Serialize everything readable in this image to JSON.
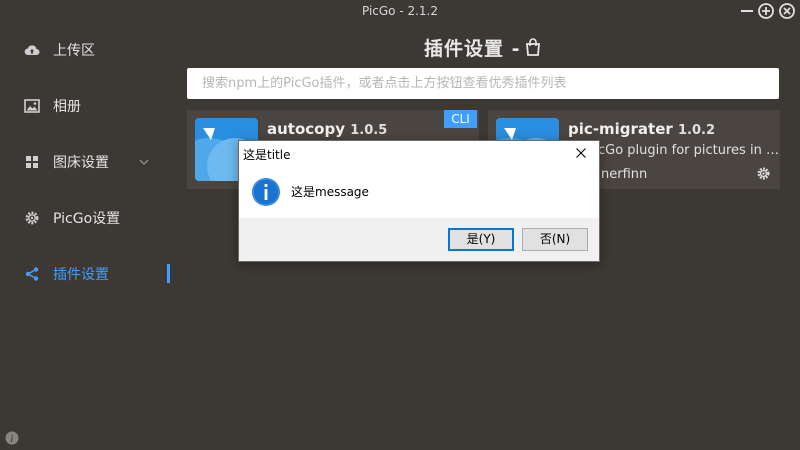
{
  "window": {
    "title": "PicGo - 2.1.2",
    "minimize_icon": "minimize-icon",
    "maximize_icon": "plus-circle-icon",
    "close_icon": "close-circle-icon"
  },
  "sidebar": {
    "items": [
      {
        "label": "上传区",
        "icon": "cloud-upload-icon"
      },
      {
        "label": "相册",
        "icon": "picture-icon"
      },
      {
        "label": "图床设置",
        "icon": "grid-icon"
      },
      {
        "label": "PicGo设置",
        "icon": "gear-icon"
      },
      {
        "label": "插件设置",
        "icon": "share-icon"
      }
    ],
    "active_index": 4,
    "footer_icon": "info-icon"
  },
  "main": {
    "title": "插件设置 -",
    "title_icon": "shopping-bag-icon",
    "search": {
      "placeholder": "搜索npm上的PicGo插件，或者点击上方按钮查看优秀插件列表",
      "value": ""
    },
    "plugins": [
      {
        "name": "autocopy",
        "version": "1.0.5",
        "description": "",
        "author": "",
        "badge": "CLI"
      },
      {
        "name": "pic-migrater",
        "version": "1.0.2",
        "description": "PicGo plugin for pictures in …",
        "description_visible": "cGo plugin for pictures in …",
        "author_visible": "nerfinn",
        "settings_icon": "gear-icon"
      }
    ]
  },
  "dialog": {
    "title": "这是title",
    "message": "这是message",
    "icon": "info-icon",
    "yes_label": "是(Y)",
    "no_label": "否(N)",
    "close_icon": "close-icon"
  },
  "colors": {
    "background": "#3c3833",
    "card": "#4a4540",
    "accent": "#409EFF",
    "dialog_footer": "#f0f0f0"
  }
}
